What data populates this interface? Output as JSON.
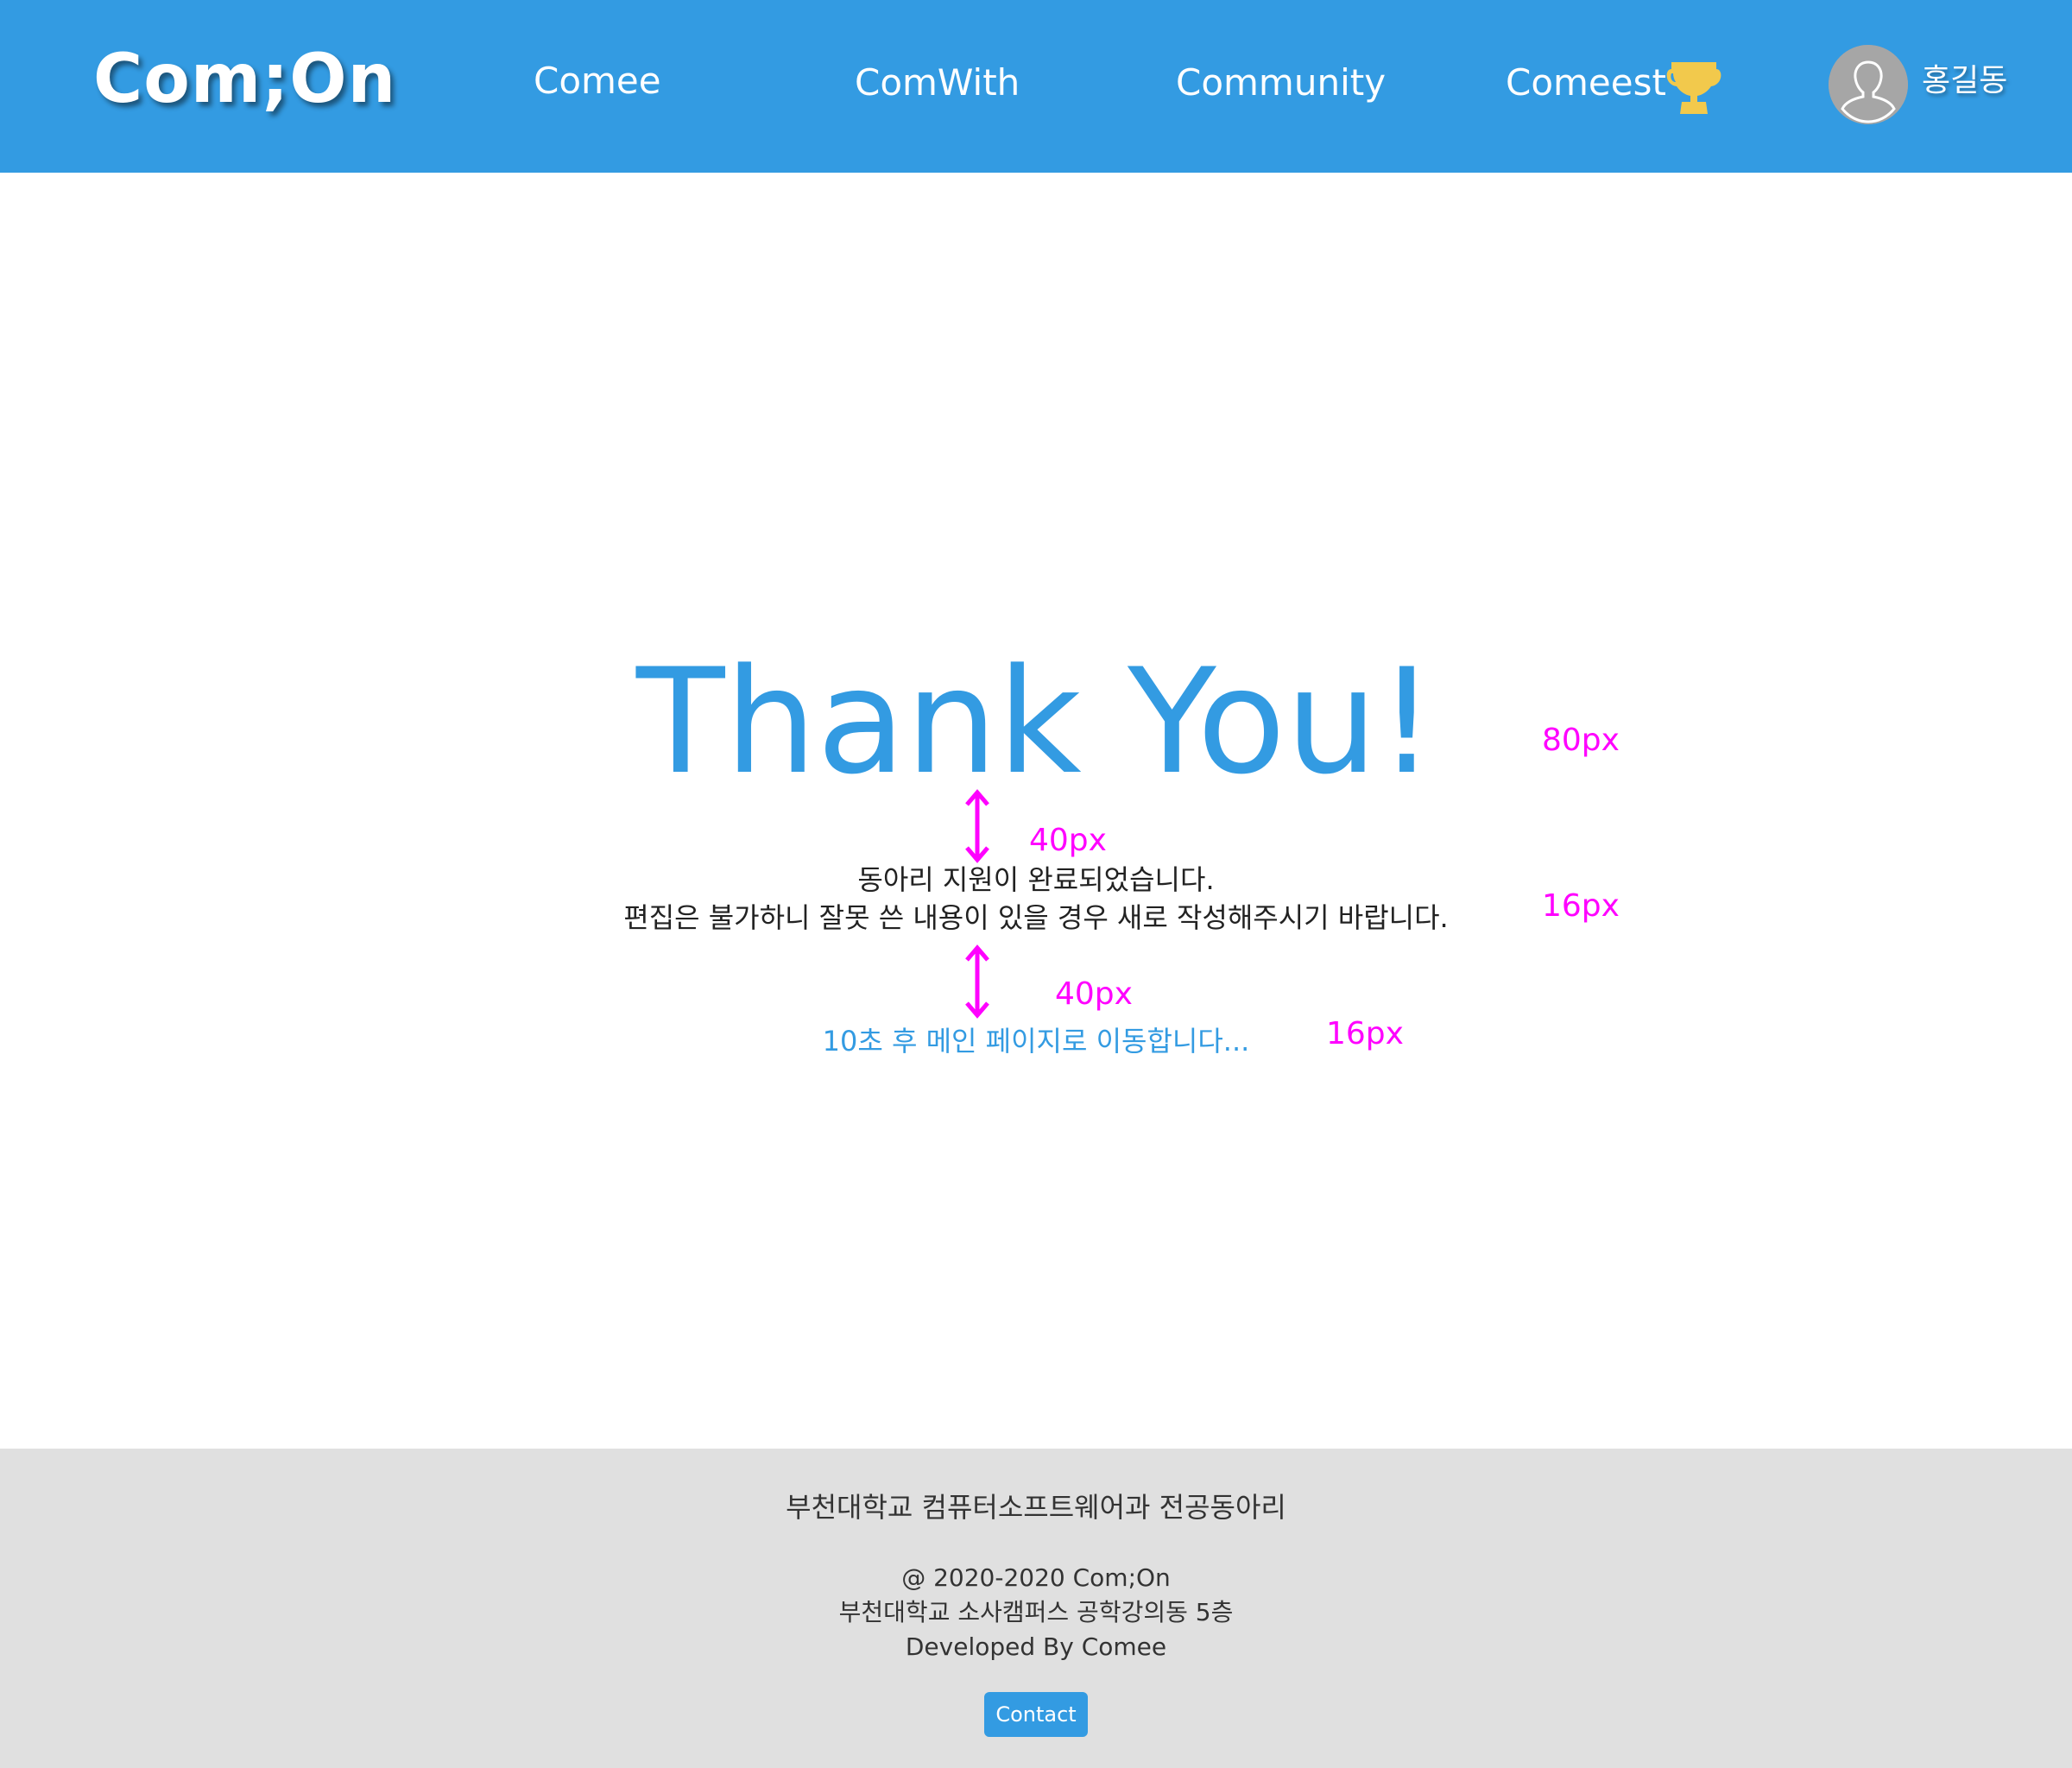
{
  "header": {
    "logo": "Com;On",
    "nav": {
      "comee": "Comee",
      "comwith": "ComWith",
      "community": "Community",
      "comeest": "Comeest"
    },
    "user": {
      "name": "홍길동",
      "avatar_icon": "user-avatar-icon"
    },
    "trophy_icon": "trophy-icon",
    "background_color": "#339be2"
  },
  "main": {
    "headline": "Thank You!",
    "message_line1": "동아리 지원이 완료되었습니다.",
    "message_line2": "편집은 불가하니 잘못 쓴 내용이 있을 경우 새로 작성해주시기 바랍니다.",
    "redirect_notice": "10초 후 메인 페이지로 이동합니다...",
    "accent_color": "#339be2"
  },
  "annotations": {
    "headline_size": "80px",
    "gap_1": "40px",
    "message_size": "16px",
    "gap_2": "40px",
    "redirect_size": "16px",
    "color": "#ff00ff",
    "arrow_icon": "double-arrow-vertical-icon"
  },
  "footer": {
    "club": "부천대학교 컴퓨터소프트웨어과 전공동아리",
    "copyright": "@ 2020-2020 Com;On",
    "address": "부천대학교 소사캠퍼스 공학강의동 5층",
    "developed_by": "Developed By Comee",
    "contact_label": "Contact",
    "background_color": "#e0e0e0"
  }
}
